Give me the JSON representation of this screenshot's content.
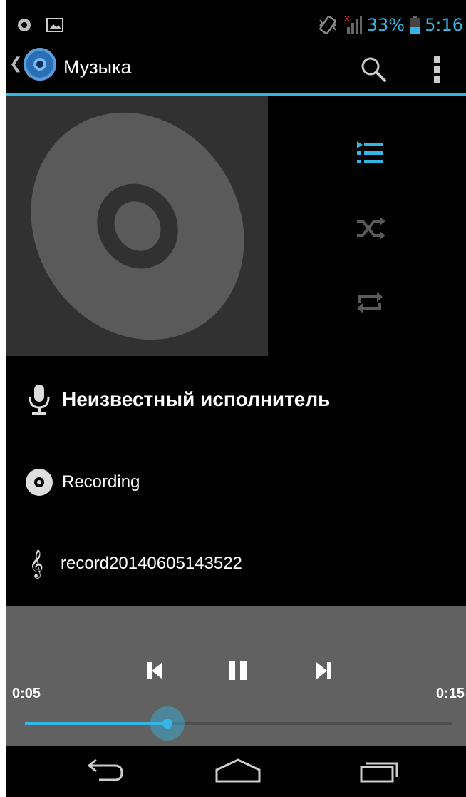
{
  "status_bar": {
    "battery": "33%",
    "time": "5:16",
    "icons": [
      "android-notif-icon",
      "picture-icon",
      "vibrate-icon",
      "signal-icon",
      "battery-icon"
    ]
  },
  "action_bar": {
    "title": "Музыка",
    "icons": [
      "back-chevron-icon",
      "music-app-icon",
      "search-icon",
      "overflow-menu-icon"
    ]
  },
  "controls": {
    "icons": [
      "queue-icon",
      "shuffle-icon",
      "repeat-icon"
    ]
  },
  "track": {
    "artist": "Неизвестный исполнитель",
    "album": "Recording",
    "title": "record20140605143522"
  },
  "transport": {
    "elapsed": "0:05",
    "total": "0:15",
    "progress": 0.333
  },
  "colors": {
    "accent": "#33b5e5",
    "background": "#000000",
    "album_bg": "#313131",
    "transport_bg": "#616161"
  }
}
